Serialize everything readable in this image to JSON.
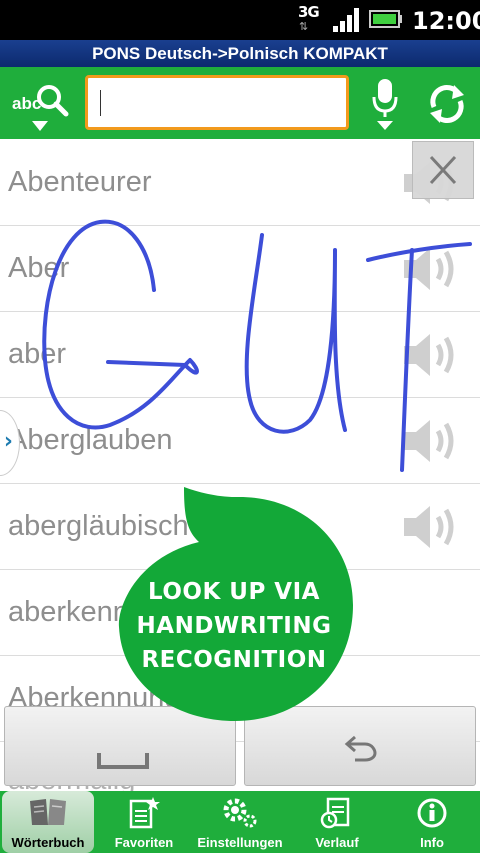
{
  "status_bar": {
    "network": "3G",
    "time": "12:00"
  },
  "title": "PONS Deutsch->Polnisch KOMPAKT",
  "toolbar": {
    "input_mode_label": "abc",
    "search_value": ""
  },
  "word_list": [
    "Abenteurer",
    "Aber",
    "aber",
    "Aberglauben",
    "abergläubisch",
    "aberkennen",
    "Aberkennung",
    "abermalig"
  ],
  "handwriting": {
    "strokes_text": "GUT"
  },
  "promo": {
    "lines": [
      "LOOK UP VIA",
      "HANDWRITING",
      "RECOGNITION"
    ]
  },
  "nav": [
    {
      "label": "Wörterbuch",
      "icon": "book-icon"
    },
    {
      "label": "Favoriten",
      "icon": "favorites-icon"
    },
    {
      "label": "Einstellungen",
      "icon": "settings-icon"
    },
    {
      "label": "Verlauf",
      "icon": "history-icon"
    },
    {
      "label": "Info",
      "icon": "info-icon"
    }
  ],
  "colors": {
    "green": "#1fae3c",
    "navy": "#0c2a6e",
    "orange": "#f29a1c",
    "ink": "#3d4ed8"
  }
}
